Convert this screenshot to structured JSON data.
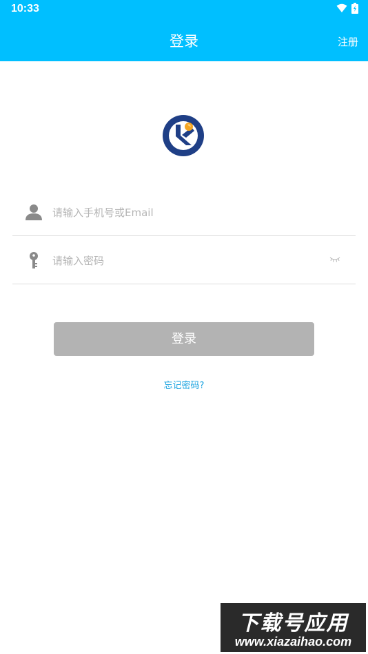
{
  "status_bar": {
    "time": "10:33",
    "icons": [
      "wifi-icon",
      "battery-charging-icon"
    ]
  },
  "header": {
    "title": "登录",
    "action_label": "注册"
  },
  "logo": {
    "icon": "app-logo-icon"
  },
  "form": {
    "phone_placeholder": "请输入手机号或Email",
    "phone_value": "",
    "password_placeholder": "请输入密码",
    "password_value": "",
    "phone_icon": "user-icon",
    "password_icon": "key-icon",
    "toggle_icon": "eye-closed-icon"
  },
  "login_button": {
    "label": "登录",
    "state": "disabled"
  },
  "forgot_link": "忘记密码?",
  "watermark": {
    "title": "下载号应用",
    "url": "www.xiazaihao.com"
  },
  "colors": {
    "accent": "#00bfff",
    "button_disabled": "#b3b3b3",
    "link": "#1ca4e0",
    "placeholder": "#b5b5b5"
  }
}
